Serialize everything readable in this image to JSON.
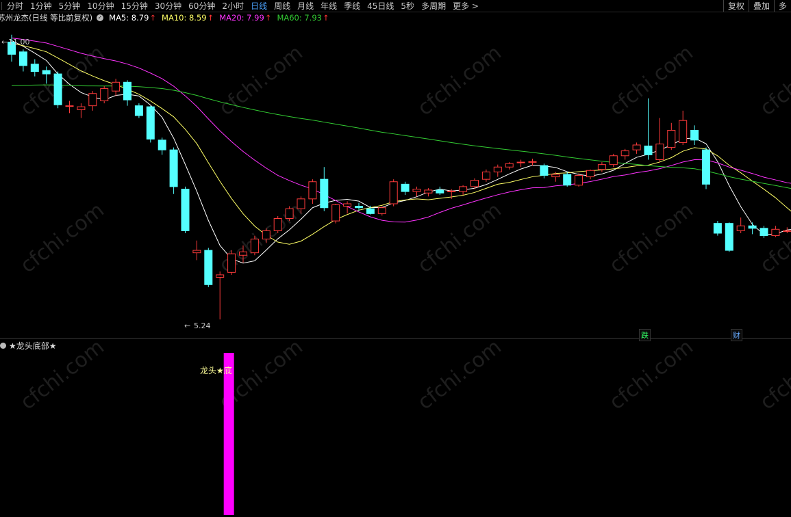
{
  "toolbar": {
    "items": [
      {
        "label": "分时",
        "active": false
      },
      {
        "label": "1分钟",
        "active": false
      },
      {
        "label": "5分钟",
        "active": false
      },
      {
        "label": "10分钟",
        "active": false
      },
      {
        "label": "15分钟",
        "active": false
      },
      {
        "label": "30分钟",
        "active": false
      },
      {
        "label": "60分钟",
        "active": false
      },
      {
        "label": "2小时",
        "active": false
      },
      {
        "label": "日线",
        "active": true
      },
      {
        "label": "周线",
        "active": false
      },
      {
        "label": "月线",
        "active": false
      },
      {
        "label": "年线",
        "active": false
      },
      {
        "label": "季线",
        "active": false
      },
      {
        "label": "45日线",
        "active": false
      },
      {
        "label": "5秒",
        "active": false
      },
      {
        "label": "多周期",
        "active": false
      },
      {
        "label": "更多 >",
        "active": false
      }
    ],
    "right": [
      "复权",
      "叠加",
      "多"
    ]
  },
  "info": {
    "title": "苏州龙杰(日线 等比前复权)",
    "ma5": {
      "label": "MA5: 8.79",
      "arrow": "↑",
      "color": "#ffffff"
    },
    "ma10": {
      "label": "MA10: 8.59",
      "arrow": "↑",
      "color": "#ffff66"
    },
    "ma20": {
      "label": "MA20: 7.99",
      "arrow": "↑",
      "color": "#ff33ff"
    },
    "ma60": {
      "label": "MA60: 7.93",
      "arrow": "↑",
      "color": "#33cc33"
    }
  },
  "price_labels": {
    "high": "11.00",
    "low": "5.24"
  },
  "badges": {
    "die": "跌",
    "cai": "财"
  },
  "indicator": {
    "title": "★龙头底部★",
    "signal_label": "龙头★底"
  },
  "watermark": "cfchi.com",
  "colors": {
    "up": "#ff3b3b",
    "down": "#54ffff",
    "ma5": "#ffffff",
    "ma10": "#ffff66",
    "ma20": "#ff33ff",
    "ma60": "#33cc33",
    "signal": "#ff00ff",
    "active": "#4aa3ff"
  },
  "chart_data": {
    "type": "candlestick",
    "candles": [
      {
        "o": 10.9,
        "h": 11.05,
        "l": 10.5,
        "c": 10.65
      },
      {
        "o": 10.7,
        "h": 10.75,
        "l": 10.3,
        "c": 10.42
      },
      {
        "o": 10.45,
        "h": 10.55,
        "l": 10.2,
        "c": 10.3
      },
      {
        "o": 10.32,
        "h": 10.4,
        "l": 10.05,
        "c": 10.25
      },
      {
        "o": 10.25,
        "h": 10.3,
        "l": 9.55,
        "c": 9.62
      },
      {
        "o": 9.6,
        "h": 9.7,
        "l": 9.45,
        "c": 9.6
      },
      {
        "o": 9.52,
        "h": 9.65,
        "l": 9.35,
        "c": 9.58
      },
      {
        "o": 9.6,
        "h": 9.9,
        "l": 9.5,
        "c": 9.85
      },
      {
        "o": 9.7,
        "h": 10.0,
        "l": 9.65,
        "c": 9.95
      },
      {
        "o": 9.9,
        "h": 10.15,
        "l": 9.8,
        "c": 10.08
      },
      {
        "o": 10.08,
        "h": 10.12,
        "l": 9.6,
        "c": 9.72
      },
      {
        "o": 9.6,
        "h": 9.65,
        "l": 9.35,
        "c": 9.4
      },
      {
        "o": 9.58,
        "h": 9.6,
        "l": 8.85,
        "c": 8.92
      },
      {
        "o": 8.9,
        "h": 8.95,
        "l": 8.6,
        "c": 8.7
      },
      {
        "o": 8.7,
        "h": 8.75,
        "l": 7.8,
        "c": 7.95
      },
      {
        "o": 7.9,
        "h": 7.95,
        "l": 7.0,
        "c": 7.05
      },
      {
        "o": 6.6,
        "h": 6.85,
        "l": 6.45,
        "c": 6.65
      },
      {
        "o": 6.65,
        "h": 6.7,
        "l": 5.9,
        "c": 5.95
      },
      {
        "o": 6.1,
        "h": 6.22,
        "l": 5.24,
        "c": 6.15
      },
      {
        "o": 6.2,
        "h": 6.65,
        "l": 6.15,
        "c": 6.58
      },
      {
        "o": 6.55,
        "h": 6.75,
        "l": 6.4,
        "c": 6.62
      },
      {
        "o": 6.6,
        "h": 6.95,
        "l": 6.55,
        "c": 6.88
      },
      {
        "o": 6.88,
        "h": 7.1,
        "l": 6.8,
        "c": 7.05
      },
      {
        "o": 7.05,
        "h": 7.35,
        "l": 7.0,
        "c": 7.3
      },
      {
        "o": 7.3,
        "h": 7.55,
        "l": 7.25,
        "c": 7.5
      },
      {
        "o": 7.5,
        "h": 7.75,
        "l": 7.4,
        "c": 7.7
      },
      {
        "o": 7.7,
        "h": 8.1,
        "l": 7.6,
        "c": 8.05
      },
      {
        "o": 8.1,
        "h": 8.35,
        "l": 7.45,
        "c": 7.52
      },
      {
        "o": 7.25,
        "h": 7.6,
        "l": 7.2,
        "c": 7.58
      },
      {
        "o": 7.55,
        "h": 7.65,
        "l": 7.4,
        "c": 7.6
      },
      {
        "o": 7.55,
        "h": 7.62,
        "l": 7.45,
        "c": 7.52
      },
      {
        "o": 7.5,
        "h": 7.56,
        "l": 7.38,
        "c": 7.4
      },
      {
        "o": 7.4,
        "h": 7.55,
        "l": 7.36,
        "c": 7.52
      },
      {
        "o": 7.6,
        "h": 8.1,
        "l": 7.55,
        "c": 8.05
      },
      {
        "o": 8.0,
        "h": 8.05,
        "l": 7.78,
        "c": 7.85
      },
      {
        "o": 7.85,
        "h": 7.95,
        "l": 7.75,
        "c": 7.9
      },
      {
        "o": 7.82,
        "h": 7.92,
        "l": 7.75,
        "c": 7.88
      },
      {
        "o": 7.88,
        "h": 7.95,
        "l": 7.78,
        "c": 7.82
      },
      {
        "o": 7.85,
        "h": 7.9,
        "l": 7.7,
        "c": 7.86
      },
      {
        "o": 7.85,
        "h": 7.98,
        "l": 7.78,
        "c": 7.95
      },
      {
        "o": 7.95,
        "h": 8.12,
        "l": 7.9,
        "c": 8.08
      },
      {
        "o": 8.1,
        "h": 8.3,
        "l": 8.05,
        "c": 8.25
      },
      {
        "o": 8.25,
        "h": 8.4,
        "l": 8.15,
        "c": 8.35
      },
      {
        "o": 8.35,
        "h": 8.45,
        "l": 8.3,
        "c": 8.42
      },
      {
        "o": 8.45,
        "h": 8.5,
        "l": 8.35,
        "c": 8.45
      },
      {
        "o": 8.45,
        "h": 8.52,
        "l": 8.38,
        "c": 8.46
      },
      {
        "o": 8.38,
        "h": 8.42,
        "l": 8.12,
        "c": 8.18
      },
      {
        "o": 8.15,
        "h": 8.25,
        "l": 8.05,
        "c": 8.2
      },
      {
        "o": 8.2,
        "h": 8.25,
        "l": 7.95,
        "c": 7.98
      },
      {
        "o": 7.98,
        "h": 8.22,
        "l": 7.95,
        "c": 8.18
      },
      {
        "o": 8.15,
        "h": 8.3,
        "l": 8.1,
        "c": 8.28
      },
      {
        "o": 8.3,
        "h": 8.45,
        "l": 8.25,
        "c": 8.4
      },
      {
        "o": 8.4,
        "h": 8.62,
        "l": 8.35,
        "c": 8.58
      },
      {
        "o": 8.58,
        "h": 8.72,
        "l": 8.5,
        "c": 8.68
      },
      {
        "o": 8.7,
        "h": 8.85,
        "l": 8.62,
        "c": 8.8
      },
      {
        "o": 8.78,
        "h": 9.75,
        "l": 8.5,
        "c": 8.6
      },
      {
        "o": 8.5,
        "h": 9.35,
        "l": 8.45,
        "c": 8.82
      },
      {
        "o": 8.75,
        "h": 9.25,
        "l": 8.7,
        "c": 9.1
      },
      {
        "o": 8.85,
        "h": 9.5,
        "l": 8.8,
        "c": 9.3
      },
      {
        "o": 9.1,
        "h": 9.2,
        "l": 8.8,
        "c": 8.9
      },
      {
        "o": 8.7,
        "h": 8.75,
        "l": 7.9,
        "c": 8.0
      },
      {
        "o": 7.2,
        "h": 7.25,
        "l": 6.95,
        "c": 7.0
      },
      {
        "o": 7.2,
        "h": 7.22,
        "l": 6.62,
        "c": 6.65
      },
      {
        "o": 7.05,
        "h": 7.32,
        "l": 7.0,
        "c": 7.15
      },
      {
        "o": 7.15,
        "h": 7.22,
        "l": 6.98,
        "c": 7.1
      },
      {
        "o": 7.1,
        "h": 7.15,
        "l": 6.9,
        "c": 6.95
      },
      {
        "o": 6.95,
        "h": 7.15,
        "l": 6.92,
        "c": 7.08
      },
      {
        "o": 7.05,
        "h": 7.12,
        "l": 7.0,
        "c": 7.05
      },
      {
        "o": 7.1,
        "h": 7.35,
        "l": 7.05,
        "c": 7.3
      },
      {
        "o": 7.32,
        "h": 7.4,
        "l": 7.25,
        "c": 7.35
      },
      {
        "o": 7.45,
        "h": 7.7,
        "l": 7.4,
        "c": 7.62
      },
      {
        "o": 7.7,
        "h": 7.9,
        "l": 7.65,
        "c": 7.85
      },
      {
        "o": 7.85,
        "h": 8.05,
        "l": 7.8,
        "c": 8.0
      },
      {
        "o": 8.1,
        "h": 8.35,
        "l": 8.05,
        "c": 8.3
      },
      {
        "o": 8.35,
        "h": 8.45,
        "l": 8.3,
        "c": 8.38
      }
    ],
    "ma": [
      {
        "name": "MA5",
        "color": "#ffffff"
      },
      {
        "name": "MA10",
        "color": "#ffff66"
      },
      {
        "name": "MA20",
        "color": "#ff33ff"
      },
      {
        "name": "MA60",
        "color": "#33cc33"
      }
    ],
    "signal_index": 18
  }
}
